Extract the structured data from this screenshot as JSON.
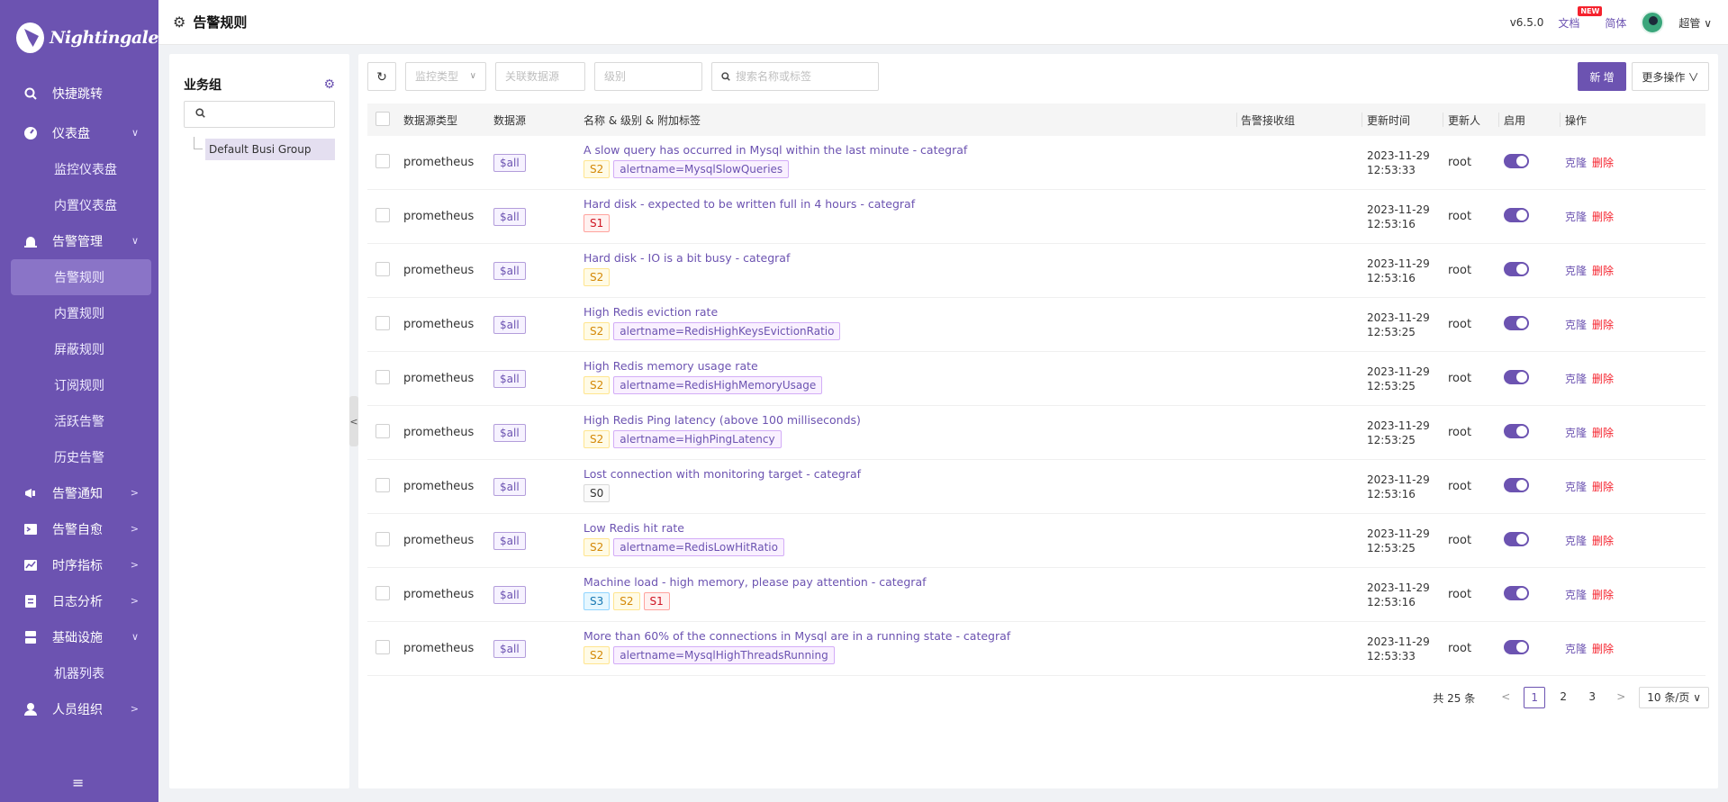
{
  "sidebar": {
    "logo_text": "Nightingale",
    "items": [
      {
        "label": "快捷跳转",
        "icon": "search-icon"
      },
      {
        "label": "仪表盘",
        "icon": "dashboard-icon"
      },
      {
        "label": "监控仪表盘"
      },
      {
        "label": "内置仪表盘"
      },
      {
        "label": "告警管理",
        "icon": "alarm-icon"
      },
      {
        "label": "告警规则"
      },
      {
        "label": "内置规则"
      },
      {
        "label": "屏蔽规则"
      },
      {
        "label": "订阅规则"
      },
      {
        "label": "活跃告警"
      },
      {
        "label": "历史告警"
      },
      {
        "label": "告警通知",
        "icon": "megaphone-icon"
      },
      {
        "label": "告警自愈",
        "icon": "terminal-icon"
      },
      {
        "label": "时序指标",
        "icon": "chart-icon"
      },
      {
        "label": "日志分析",
        "icon": "log-icon"
      },
      {
        "label": "基础设施",
        "icon": "server-icon"
      },
      {
        "label": "机器列表"
      },
      {
        "label": "人员组织",
        "icon": "user-icon"
      }
    ]
  },
  "header": {
    "title": "告警规则",
    "version": "v6.5.0",
    "docs": "文档",
    "new_badge": "NEW",
    "lang": "简体",
    "user": "超管"
  },
  "busi_group": {
    "title": "业务组",
    "search_placeholder": "",
    "groups": [
      "Default Busi Group"
    ]
  },
  "toolbar": {
    "monitor_type_placeholder": "监控类型",
    "datasource_placeholder": "关联数据源",
    "level_placeholder": "级别",
    "search_placeholder": "搜索名称或标签",
    "new_label": "新 增",
    "more_label": "更多操作"
  },
  "table": {
    "columns": [
      "数据源类型",
      "数据源",
      "名称 & 级别 & 附加标签",
      "告警接收组",
      "更新时间",
      "更新人",
      "启用",
      "操作"
    ],
    "clone_label": "克隆",
    "delete_label": "删除",
    "rows": [
      {
        "type": "prometheus",
        "ds": "$all",
        "name": "A slow query has occurred in Mysql within the last minute - categraf",
        "levels": [
          "S2"
        ],
        "labels": [
          "alertname=MysqlSlowQueries"
        ],
        "date": "2023-11-29",
        "time": "12:53:33",
        "updater": "root",
        "enabled": true
      },
      {
        "type": "prometheus",
        "ds": "$all",
        "name": "Hard disk - expected to be written full in 4 hours - categraf",
        "levels": [
          "S1"
        ],
        "labels": [],
        "date": "2023-11-29",
        "time": "12:53:16",
        "updater": "root",
        "enabled": true
      },
      {
        "type": "prometheus",
        "ds": "$all",
        "name": "Hard disk - IO is a bit busy - categraf",
        "levels": [
          "S2"
        ],
        "labels": [],
        "date": "2023-11-29",
        "time": "12:53:16",
        "updater": "root",
        "enabled": true
      },
      {
        "type": "prometheus",
        "ds": "$all",
        "name": "High Redis eviction rate",
        "levels": [
          "S2"
        ],
        "labels": [
          "alertname=RedisHighKeysEvictionRatio"
        ],
        "date": "2023-11-29",
        "time": "12:53:25",
        "updater": "root",
        "enabled": true
      },
      {
        "type": "prometheus",
        "ds": "$all",
        "name": "High Redis memory usage rate",
        "levels": [
          "S2"
        ],
        "labels": [
          "alertname=RedisHighMemoryUsage"
        ],
        "date": "2023-11-29",
        "time": "12:53:25",
        "updater": "root",
        "enabled": true
      },
      {
        "type": "prometheus",
        "ds": "$all",
        "name": "High Redis Ping latency (above 100 milliseconds)",
        "levels": [
          "S2"
        ],
        "labels": [
          "alertname=HighPingLatency"
        ],
        "date": "2023-11-29",
        "time": "12:53:25",
        "updater": "root",
        "enabled": true
      },
      {
        "type": "prometheus",
        "ds": "$all",
        "name": "Lost connection with monitoring target - categraf",
        "levels": [
          "S0"
        ],
        "labels": [],
        "date": "2023-11-29",
        "time": "12:53:16",
        "updater": "root",
        "enabled": true
      },
      {
        "type": "prometheus",
        "ds": "$all",
        "name": "Low Redis hit rate",
        "levels": [
          "S2"
        ],
        "labels": [
          "alertname=RedisLowHitRatio"
        ],
        "date": "2023-11-29",
        "time": "12:53:25",
        "updater": "root",
        "enabled": true
      },
      {
        "type": "prometheus",
        "ds": "$all",
        "name": "Machine load - high memory, please pay attention - categraf",
        "levels": [
          "S3",
          "S2",
          "S1"
        ],
        "labels": [],
        "date": "2023-11-29",
        "time": "12:53:16",
        "updater": "root",
        "enabled": true
      },
      {
        "type": "prometheus",
        "ds": "$all",
        "name": "More than 60% of the connections in Mysql are in a running state - categraf",
        "levels": [
          "S2"
        ],
        "labels": [
          "alertname=MysqlHighThreadsRunning"
        ],
        "date": "2023-11-29",
        "time": "12:53:33",
        "updater": "root",
        "enabled": true
      }
    ]
  },
  "pagination": {
    "total": "共 25 条",
    "pages": [
      "1",
      "2",
      "3"
    ],
    "current": "1",
    "page_size": "10 条/页"
  },
  "colors": {
    "brand": "#6c53b1",
    "danger": "#f5222d"
  }
}
